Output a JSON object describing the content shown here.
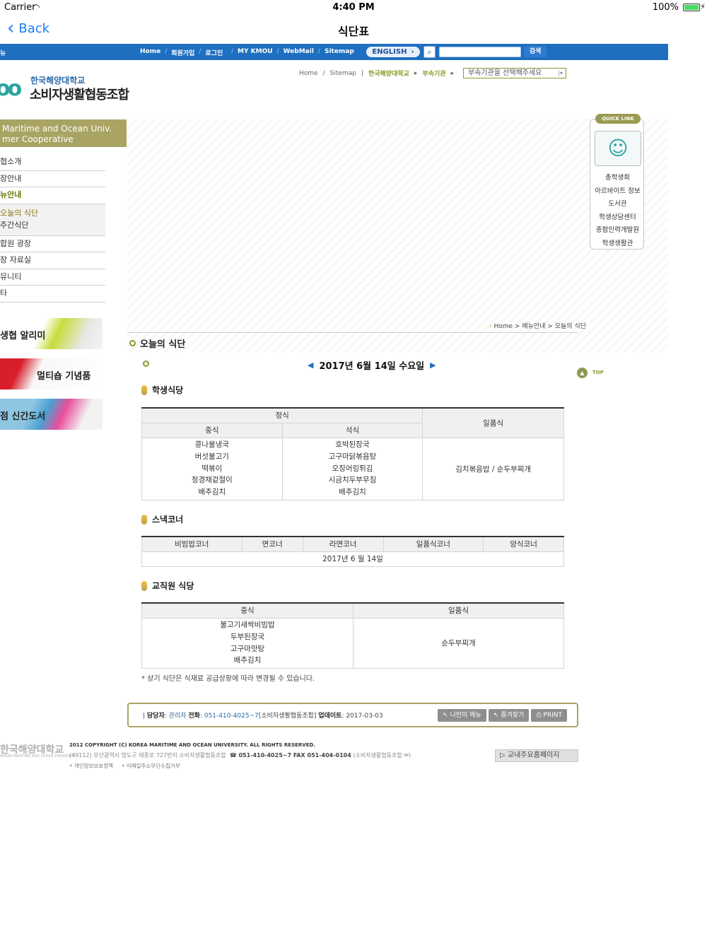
{
  "status": {
    "carrier": "Carrier",
    "time": "4:40 PM",
    "battery": "100%",
    "battery_level": 1.0
  },
  "nav": {
    "back": "Back",
    "title": "식단표"
  },
  "topbar": {
    "menu_cut": "뉴",
    "links": [
      "Home",
      "회원가입",
      "로그인",
      "MY KMOU",
      "WebMail",
      "Sitemap"
    ],
    "english": "ENGLISH",
    "search_button": "검색",
    "search_value": ""
  },
  "logo": {
    "univ": "한국해양대학교",
    "coop": "소비자생활협동조합",
    "mark": "oo"
  },
  "breadcrumb_top": {
    "home": "Home",
    "sitemap": "Sitemap",
    "univ": "한국해양대학교",
    "dept": "부속기관",
    "select": "부속기관을 선택해주세요"
  },
  "left_header": {
    "line1": "Maritime and Ocean Univ.",
    "line2": "mer Cooperative"
  },
  "lnb": {
    "items_top": [
      "협소개",
      "장안내",
      "뉴안내"
    ],
    "sub": [
      "오늘의 식단",
      "주간식단"
    ],
    "items_bottom": [
      "합원 광장",
      "장 자료실",
      "뮤니티",
      "타"
    ]
  },
  "promos": [
    "생협 알리미",
    "멀티숍 기념품",
    "점 신간도서"
  ],
  "quick": {
    "tag": "QUICK LINK",
    "links": [
      "총학생회",
      "아르바이트 정보",
      "도서관",
      "학생상담센터",
      "종합인력개발원",
      "학생생활관"
    ]
  },
  "location": {
    "text": "Home > 메뉴안내 > 오늘의 식단"
  },
  "page_title": "오늘의 식단",
  "date": "2017년 6월 14일 수요일",
  "top_button": "TOP",
  "student": {
    "title": "학생식당",
    "group": "정식",
    "lunch_label": "중식",
    "dinner_label": "석식",
    "single_label": "일품식",
    "lunch": [
      "콩나물냉국",
      "버섯불고기",
      "떡볶이",
      "청경채겉절이",
      "배추김치"
    ],
    "dinner": [
      "호박된장국",
      "고구마닭볶음탕",
      "오징어링튀김",
      "시금치두부무침",
      "배추김치"
    ],
    "single": "김치볶음밥 / 순두부찌개"
  },
  "snack": {
    "title": "스낵코너",
    "cols": [
      "비빔밥코너",
      "면코너",
      "라면코너",
      "일품식코너",
      "양식코너"
    ],
    "date": "2017년 6 월 14일"
  },
  "staff": {
    "title": "교직원 식당",
    "lunch_label": "중식",
    "single_label": "일품식",
    "lunch": [
      "불고기새싹비빔밥",
      "두부된장국",
      "고구마맛탕",
      "배추김치"
    ],
    "single": "순두부찌개"
  },
  "note": "* 상기 식단은 식재료 공급상황에 따라 변경될 수 있습니다.",
  "info": {
    "manager_label": "담당자",
    "manager": "관리자",
    "phone_label": "전화",
    "phone": "051-410-4025~7",
    "phone_org": "[소비자생활협동조합]",
    "update_label": "업데이트",
    "update": "2017-03-03",
    "btn_mymenu": "나만의 메뉴",
    "btn_fav": "즐겨찾기",
    "btn_print": "PRINT"
  },
  "footer": {
    "logo": "한국해양대학교",
    "logo_sub": "KOREA MARITIME AND OCEAN UNIVERSITY",
    "copyright": "2012 COPYRIGHT (C) KOREA MARITIME AND OCEAN UNIVERSITY. ALL RIGHTS RESERVED.",
    "address": "(49112) 부산광역시 영도구 태종로 727번지 소비자생활협동조합",
    "tel": "☎ 051-410-4025~7 FAX 051-404-0104",
    "org": "(소비자생활협동조합 ✉)",
    "policy1": "개인정보보호정책",
    "policy2": "이메일주소무단수집거부",
    "homepage_btn": "교내주요홈페이지"
  }
}
